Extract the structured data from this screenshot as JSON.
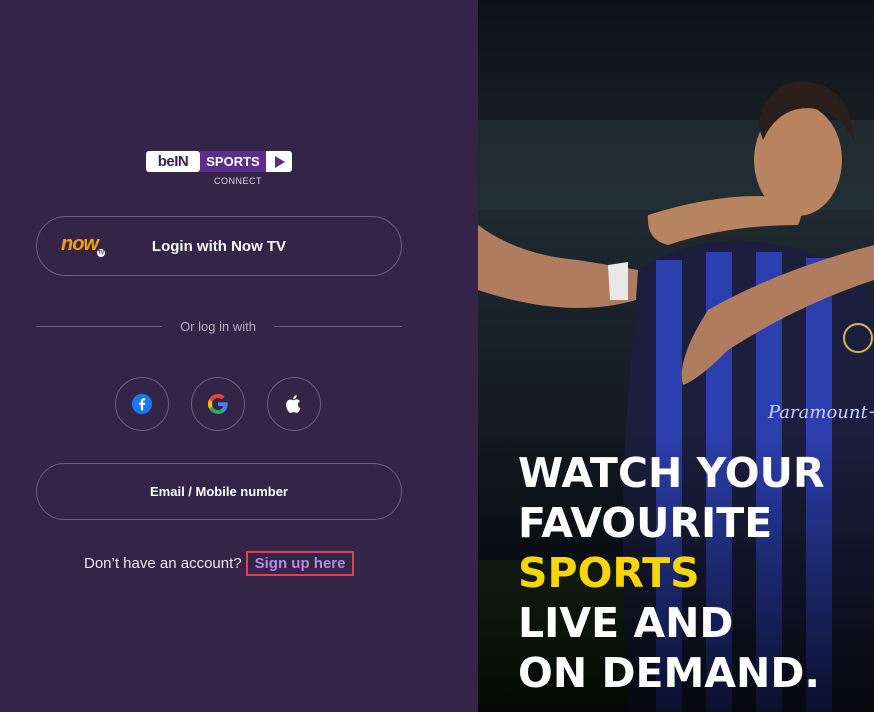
{
  "brand": {
    "logo_main": "beIN",
    "logo_sports": "SPORTS",
    "logo_sub": "CONNECT"
  },
  "login": {
    "nowtv_logo": "now",
    "nowtv_logo_badge": "TV",
    "nowtv_label": "Login with Now TV",
    "divider_text": "Or log in with",
    "social": [
      {
        "name": "facebook-icon",
        "color": "#1877F2"
      },
      {
        "name": "google-icon",
        "color": "#4285F4"
      },
      {
        "name": "apple-icon",
        "color": "#FFFFFF"
      }
    ],
    "email_label": "Email / Mobile number",
    "signup_prompt": "Don’t have an account?",
    "signup_link": "Sign up here"
  },
  "hero": {
    "line1": "WATCH YOUR",
    "line2": "FAVOURITE",
    "line3_highlight": "SPORTS",
    "line4": "LIVE AND",
    "line5": "ON DEMAND.",
    "highlight_color": "#F6D60B"
  },
  "colors": {
    "panel_bg": "#342447",
    "accent_link": "#B68AE6",
    "border": "#6E5D82"
  }
}
